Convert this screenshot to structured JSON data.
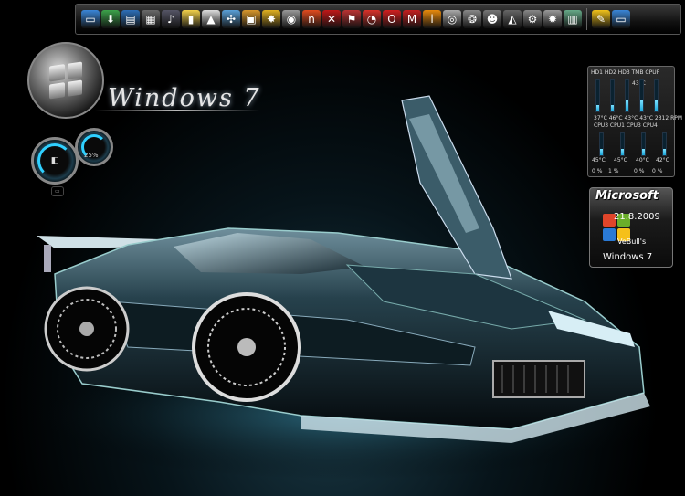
{
  "dock": {
    "icons": [
      {
        "name": "computer-icon",
        "color": "#3a86d8",
        "glyph": "▭"
      },
      {
        "name": "download-icon",
        "color": "#3ca34a",
        "glyph": "⬇"
      },
      {
        "name": "monitor-icon",
        "color": "#2d6fb8",
        "glyph": "▤"
      },
      {
        "name": "media-player-icon",
        "color": "#6a6a6a",
        "glyph": "▦"
      },
      {
        "name": "music-icon",
        "color": "#556",
        "glyph": "♪"
      },
      {
        "name": "notes-icon",
        "color": "#f2d14a",
        "glyph": "▮"
      },
      {
        "name": "cone-icon",
        "color": "#ddd",
        "glyph": "▲"
      },
      {
        "name": "resize-icon",
        "color": "#5aa0d8",
        "glyph": "✣"
      },
      {
        "name": "package-icon",
        "color": "#d8962c",
        "glyph": "▣"
      },
      {
        "name": "gadget-icon",
        "color": "#e0b020",
        "glyph": "✸"
      },
      {
        "name": "camera-icon",
        "color": "#999",
        "glyph": "◉"
      },
      {
        "name": "nero-icon",
        "color": "#e14b1f",
        "glyph": "n"
      },
      {
        "name": "x-tool-icon",
        "color": "#c01818",
        "glyph": "✕"
      },
      {
        "name": "pin-icon",
        "color": "#b33",
        "glyph": "⚑"
      },
      {
        "name": "spiral-icon",
        "color": "#d9322a",
        "glyph": "◔"
      },
      {
        "name": "opera-icon",
        "color": "#d01f1f",
        "glyph": "O"
      },
      {
        "name": "mcafee-icon",
        "color": "#c41f1f",
        "glyph": "M"
      },
      {
        "name": "info-icon",
        "color": "#e88a0c",
        "glyph": "i"
      },
      {
        "name": "disc-icon",
        "color": "#aaa",
        "glyph": "◎"
      },
      {
        "name": "film-reel-icon",
        "color": "#888",
        "glyph": "❂"
      },
      {
        "name": "user-icon",
        "color": "#777",
        "glyph": "☻"
      },
      {
        "name": "chart-tool-icon",
        "color": "#666",
        "glyph": "◭"
      },
      {
        "name": "settings-icon",
        "color": "#888",
        "glyph": "⚙"
      },
      {
        "name": "gear-icon",
        "color": "#999",
        "glyph": "✹"
      },
      {
        "name": "device-manager-icon",
        "color": "#6a8",
        "glyph": "▥"
      },
      {
        "name": "tools-icon",
        "color": "#f1c21a",
        "glyph": "✎"
      },
      {
        "name": "display-icon",
        "color": "#3a86d8",
        "glyph": "▭"
      }
    ]
  },
  "desktop": {
    "title": "Windows 7"
  },
  "gauges": {
    "ram_value": "25%"
  },
  "sensor": {
    "header": "HD1 HD2 HD3 TMB CPUF",
    "top_value": "43°C",
    "row1": "37°C 46°C 43°C 43°C 2312 RPM",
    "row1_labels": "CPU3   CPU1   CPU3   CPU4",
    "cpu_temps": [
      "45°C",
      "45°C",
      "40°C",
      "42°C"
    ],
    "cpu_loads": [
      "0 %",
      "1 %",
      "0 %",
      "0 %"
    ],
    "top_bar_levels": [
      0.2,
      0.2,
      0.35,
      0.35,
      0.35
    ],
    "bottom_bar_levels": [
      0.3,
      0.3,
      0.3,
      0.3
    ]
  },
  "ms_gadget": {
    "title": "Microsoft",
    "date": "21.8.2009",
    "user": "VeBull's",
    "version": "Windows 7",
    "logo_colors": [
      "#e0452a",
      "#6aae2a",
      "#2a7ad6",
      "#f5c01a"
    ]
  }
}
